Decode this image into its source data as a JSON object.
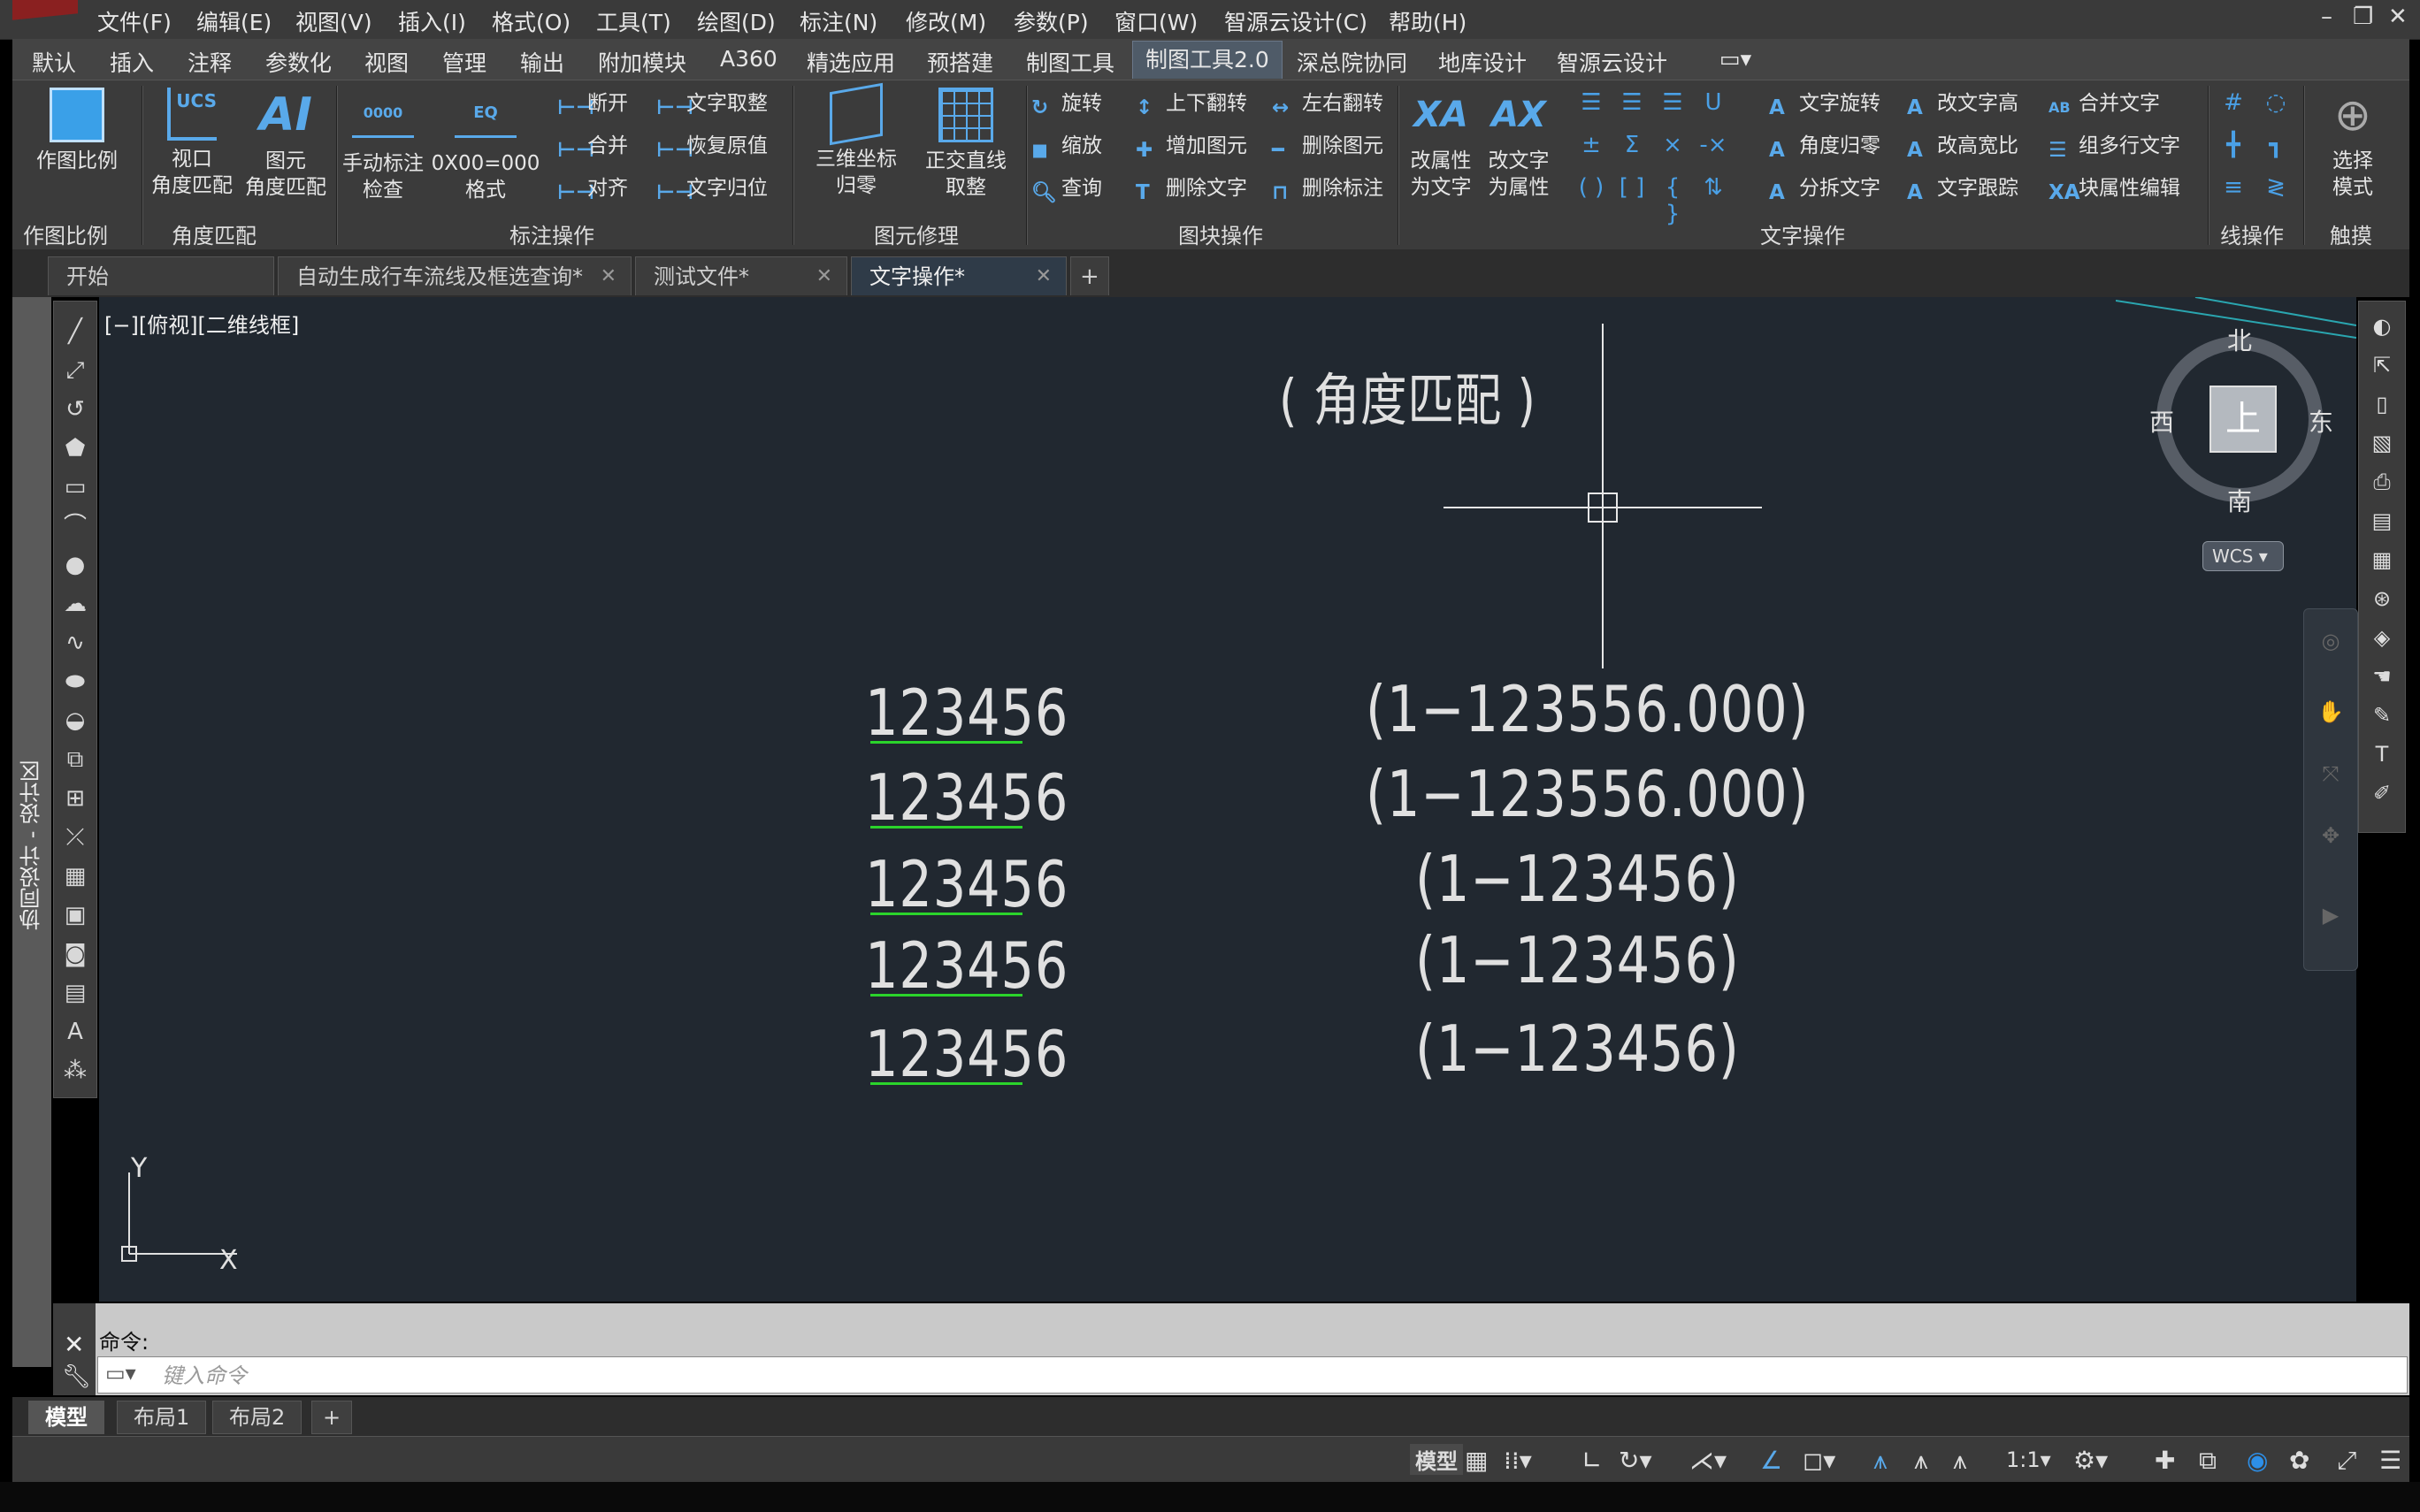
{
  "menu": [
    "文件(F)",
    "编辑(E)",
    "视图(V)",
    "插入(I)",
    "格式(O)",
    "工具(T)",
    "绘图(D)",
    "标注(N)",
    "修改(M)",
    "参数(P)",
    "窗口(W)",
    "智源云设计(C)",
    "帮助(H)"
  ],
  "ribbon_tabs": [
    "默认",
    "插入",
    "注释",
    "参数化",
    "视图",
    "管理",
    "输出",
    "附加模块",
    "A360",
    "精选应用",
    "预搭建",
    "制图工具",
    "制图工具2.0",
    "深总院协同",
    "地库设计",
    "智源云设计"
  ],
  "ribbon": {
    "groups": [
      "作图比例",
      "角度匹配",
      "标注操作",
      "图元修理",
      "图块操作",
      "文字操作",
      "线操作",
      "触摸"
    ],
    "big_buttons": {
      "scale": "作图比例",
      "vp_angle_1": "视口",
      "vp_angle_2": "角度匹配",
      "elem_angle_1": "图元",
      "elem_angle_2": "角度匹配",
      "manual_dim_1": "手动标注",
      "manual_dim_2": "检查",
      "format_1": "0X00=000",
      "format_2": "格式",
      "coord_1": "三维坐标",
      "coord_2": "归零",
      "ortho_1": "正交直线",
      "ortho_2": "取整",
      "attr2text_1": "改属性",
      "attr2text_2": "为文字",
      "text2attr_1": "改文字",
      "text2attr_2": "为属性",
      "select_1": "选择",
      "select_2": "模式"
    },
    "icon_labels": {
      "ucs": "UCS",
      "eq": "EQ",
      "dim": "0000"
    },
    "small_buttons": {
      "break": "断开",
      "merge": "合并",
      "align": "对齐",
      "text_round": "文字取整",
      "restore": "恢复原值",
      "text_home": "文字归位",
      "rotate": "旋转",
      "scale": "缩放",
      "query": "查询",
      "flip_v": "上下翻转",
      "add_elem": "增加图元",
      "del_text": "删除文字",
      "flip_h": "左右翻转",
      "del_elem": "删除图元",
      "del_dim": "删除标注",
      "text_rotate": "文字旋转",
      "angle_zero": "角度归零",
      "split_text": "分拆文字",
      "text_height": "改文字高",
      "width_ratio": "改高宽比",
      "text_track": "文字跟踪",
      "merge_text": "合并文字",
      "multiline": "组多行文字",
      "block_attr": "块属性编辑"
    }
  },
  "doc_tabs": [
    "开始",
    "自动生成行车流线及框选查询*",
    "测试文件*",
    "文字操作*"
  ],
  "left_panel_label": "协同设计 - 设计区",
  "canvas": {
    "view_label": "[−][俯视][二维线框]",
    "title": "( 角度匹配 )",
    "left_texts": [
      "123456",
      "123456",
      "123456",
      "123456",
      "123456"
    ],
    "right_texts": [
      "(1−123556.000)",
      "(1−123556.000)",
      "(1−123456)",
      "(1−123456)",
      "(1−123456)"
    ],
    "ucs_y": "Y",
    "ucs_x": "X",
    "colors": {
      "background": "#212830",
      "underline": "#2bd42b",
      "text": "#e0e0e0"
    }
  },
  "viewcube": {
    "north": "北",
    "south": "南",
    "east": "东",
    "west": "西",
    "face": "上",
    "wcs": "WCS"
  },
  "command": {
    "history": "命令:",
    "placeholder": "键入命令"
  },
  "layout_tabs": [
    "模型",
    "布局1",
    "布局2"
  ],
  "status": {
    "model": "模型",
    "scale": "1:1"
  }
}
